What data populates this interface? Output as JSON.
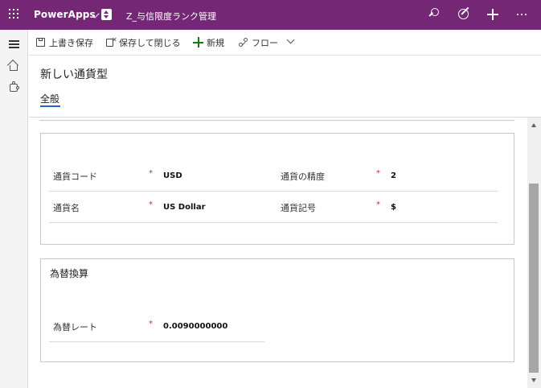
{
  "topbar": {
    "brand": "PowerApps",
    "app_title": "Z_与信限度ランク管理",
    "icons": [
      "waffle-icon",
      "search-icon",
      "target-icon",
      "plus-icon",
      "more-icon"
    ],
    "color": "#742774"
  },
  "leftnav": {
    "icons": [
      "hamburger-icon",
      "home-icon",
      "puzzle-icon"
    ]
  },
  "commandbar": {
    "save": "上書き保存",
    "save_close": "保存して閉じる",
    "new": "新規",
    "flow": "フロー"
  },
  "header": {
    "title": "新しい通貨型",
    "tab_general": "全般",
    "tab_color": "#2266c4"
  },
  "section1": {
    "fields": [
      {
        "label": "通貨コード",
        "required": "*",
        "value": "USD"
      },
      {
        "label": "通貨の精度",
        "required": "*",
        "value": "2"
      },
      {
        "label": "通貨名",
        "required": "*",
        "value": "US Dollar"
      },
      {
        "label": "通貨記号",
        "required": "*",
        "value": "$"
      }
    ]
  },
  "section2": {
    "title": "為替換算",
    "fields": [
      {
        "label": "為替レート",
        "required": "*",
        "value": "0.0090000000"
      }
    ]
  }
}
